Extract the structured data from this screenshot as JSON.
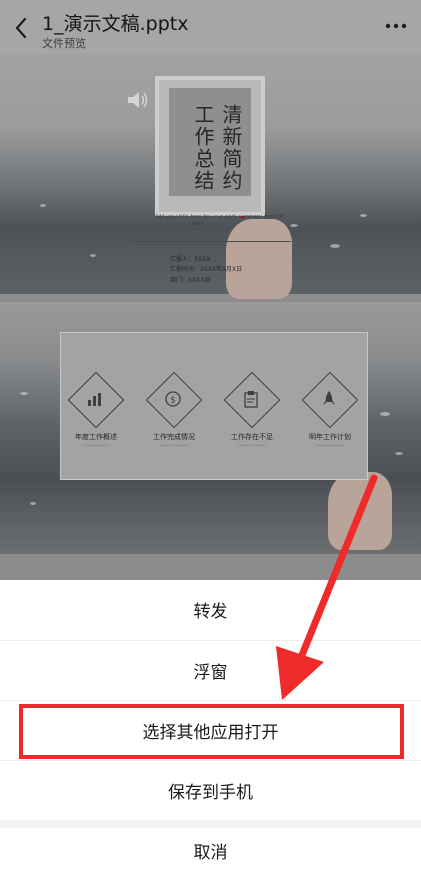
{
  "header": {
    "title": "1_演示文稿.pptx",
    "subtitle": "文件预览"
  },
  "slide1": {
    "title": "清新简约工作总结",
    "tagline_lines": [
      "Add your title here for your work summary and this",
      "slide"
    ],
    "info_lines": [
      "汇报人：XXXX",
      "汇报时间：20XX年X月X日",
      "部门：XXXX部"
    ]
  },
  "slide2": {
    "items": [
      {
        "label": "年度工作概述",
        "icon": "chart-icon"
      },
      {
        "label": "工作完成情况",
        "icon": "money-icon"
      },
      {
        "label": "工作存在不足",
        "icon": "clipboard-icon"
      },
      {
        "label": "明年工作计划",
        "icon": "rocket-icon"
      }
    ]
  },
  "sheet": {
    "options": [
      "转发",
      "浮窗",
      "选择其他应用打开",
      "保存到手机"
    ],
    "cancel": "取消"
  },
  "annotation": {
    "color": "#ee2a2a",
    "highlighted_option": "选择其他应用打开"
  }
}
